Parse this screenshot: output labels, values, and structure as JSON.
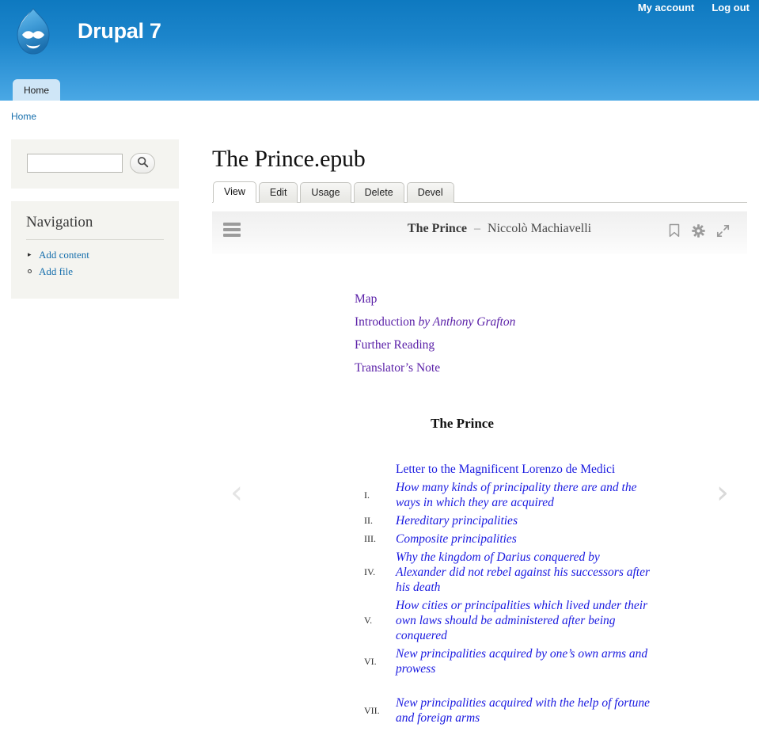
{
  "header": {
    "site_name": "Drupal 7",
    "logo_icon": "drupal-droplet-icon",
    "user_links": [
      {
        "label": "My account"
      },
      {
        "label": "Log out"
      }
    ],
    "menu": [
      {
        "label": "Home"
      }
    ]
  },
  "breadcrumb": {
    "items": [
      {
        "label": "Home"
      }
    ]
  },
  "sidebar": {
    "search": {
      "value": "",
      "placeholder": "",
      "button_icon": "search-icon"
    },
    "navigation": {
      "title": "Navigation",
      "items": [
        {
          "label": "Add content",
          "bullet": "triangle"
        },
        {
          "label": "Add file",
          "bullet": "circle"
        }
      ]
    }
  },
  "main": {
    "page_title": "The Prince.epub",
    "tabs": [
      {
        "label": "View",
        "active": true
      },
      {
        "label": "Edit",
        "active": false
      },
      {
        "label": "Usage",
        "active": false
      },
      {
        "label": "Delete",
        "active": false
      },
      {
        "label": "Devel",
        "active": false
      }
    ]
  },
  "reader": {
    "menu_icon": "hamburger-icon",
    "book_title": "The Prince",
    "separator": "–",
    "book_author": "Niccolò Machiavelli",
    "tools": [
      {
        "icon": "bookmark-icon"
      },
      {
        "icon": "gear-icon"
      },
      {
        "icon": "expand-icon"
      }
    ],
    "prev_arrow": "‹",
    "next_arrow": "›",
    "front_matter": [
      {
        "text": "Map",
        "italic_suffix": ""
      },
      {
        "text": "Introduction ",
        "italic_suffix": "by Anthony Grafton"
      },
      {
        "text": "Further Reading",
        "italic_suffix": ""
      },
      {
        "text": "Translator’s Note",
        "italic_suffix": ""
      }
    ],
    "section_title": "The Prince",
    "toc": [
      {
        "num": "",
        "label": "Letter to the Magnificent Lorenzo de Medici",
        "style": "plain"
      },
      {
        "num": "I.",
        "label": "How many kinds of principality there are and the ways in which they are acquired",
        "style": "italic"
      },
      {
        "num": "II.",
        "label": "Hereditary principalities",
        "style": "italic"
      },
      {
        "num": "III.",
        "label": "Composite principalities",
        "style": "italic"
      },
      {
        "num": "IV.",
        "label": "Why the kingdom of Darius conquered by Alexander did not rebel against his successors after his death",
        "style": "italic"
      },
      {
        "num": "V.",
        "label": "How cities or principalities which lived under their own laws should be administered after being conquered",
        "style": "italic"
      },
      {
        "num": "VI.",
        "label": "New principalities acquired by one’s own arms and prowess",
        "style": "italic"
      },
      {
        "num": "VII.",
        "label": "New principalities acquired with the help of fortune and foreign arms",
        "style": "italic"
      }
    ]
  },
  "colors": {
    "header_blue_top": "#0e79c0",
    "header_blue_bottom": "#4aa8e5",
    "link_blue": "#166fad",
    "toc_link_blue": "#1a1ae0",
    "visited_purple": "#5b21a8",
    "block_bg": "#f4f4f0"
  }
}
